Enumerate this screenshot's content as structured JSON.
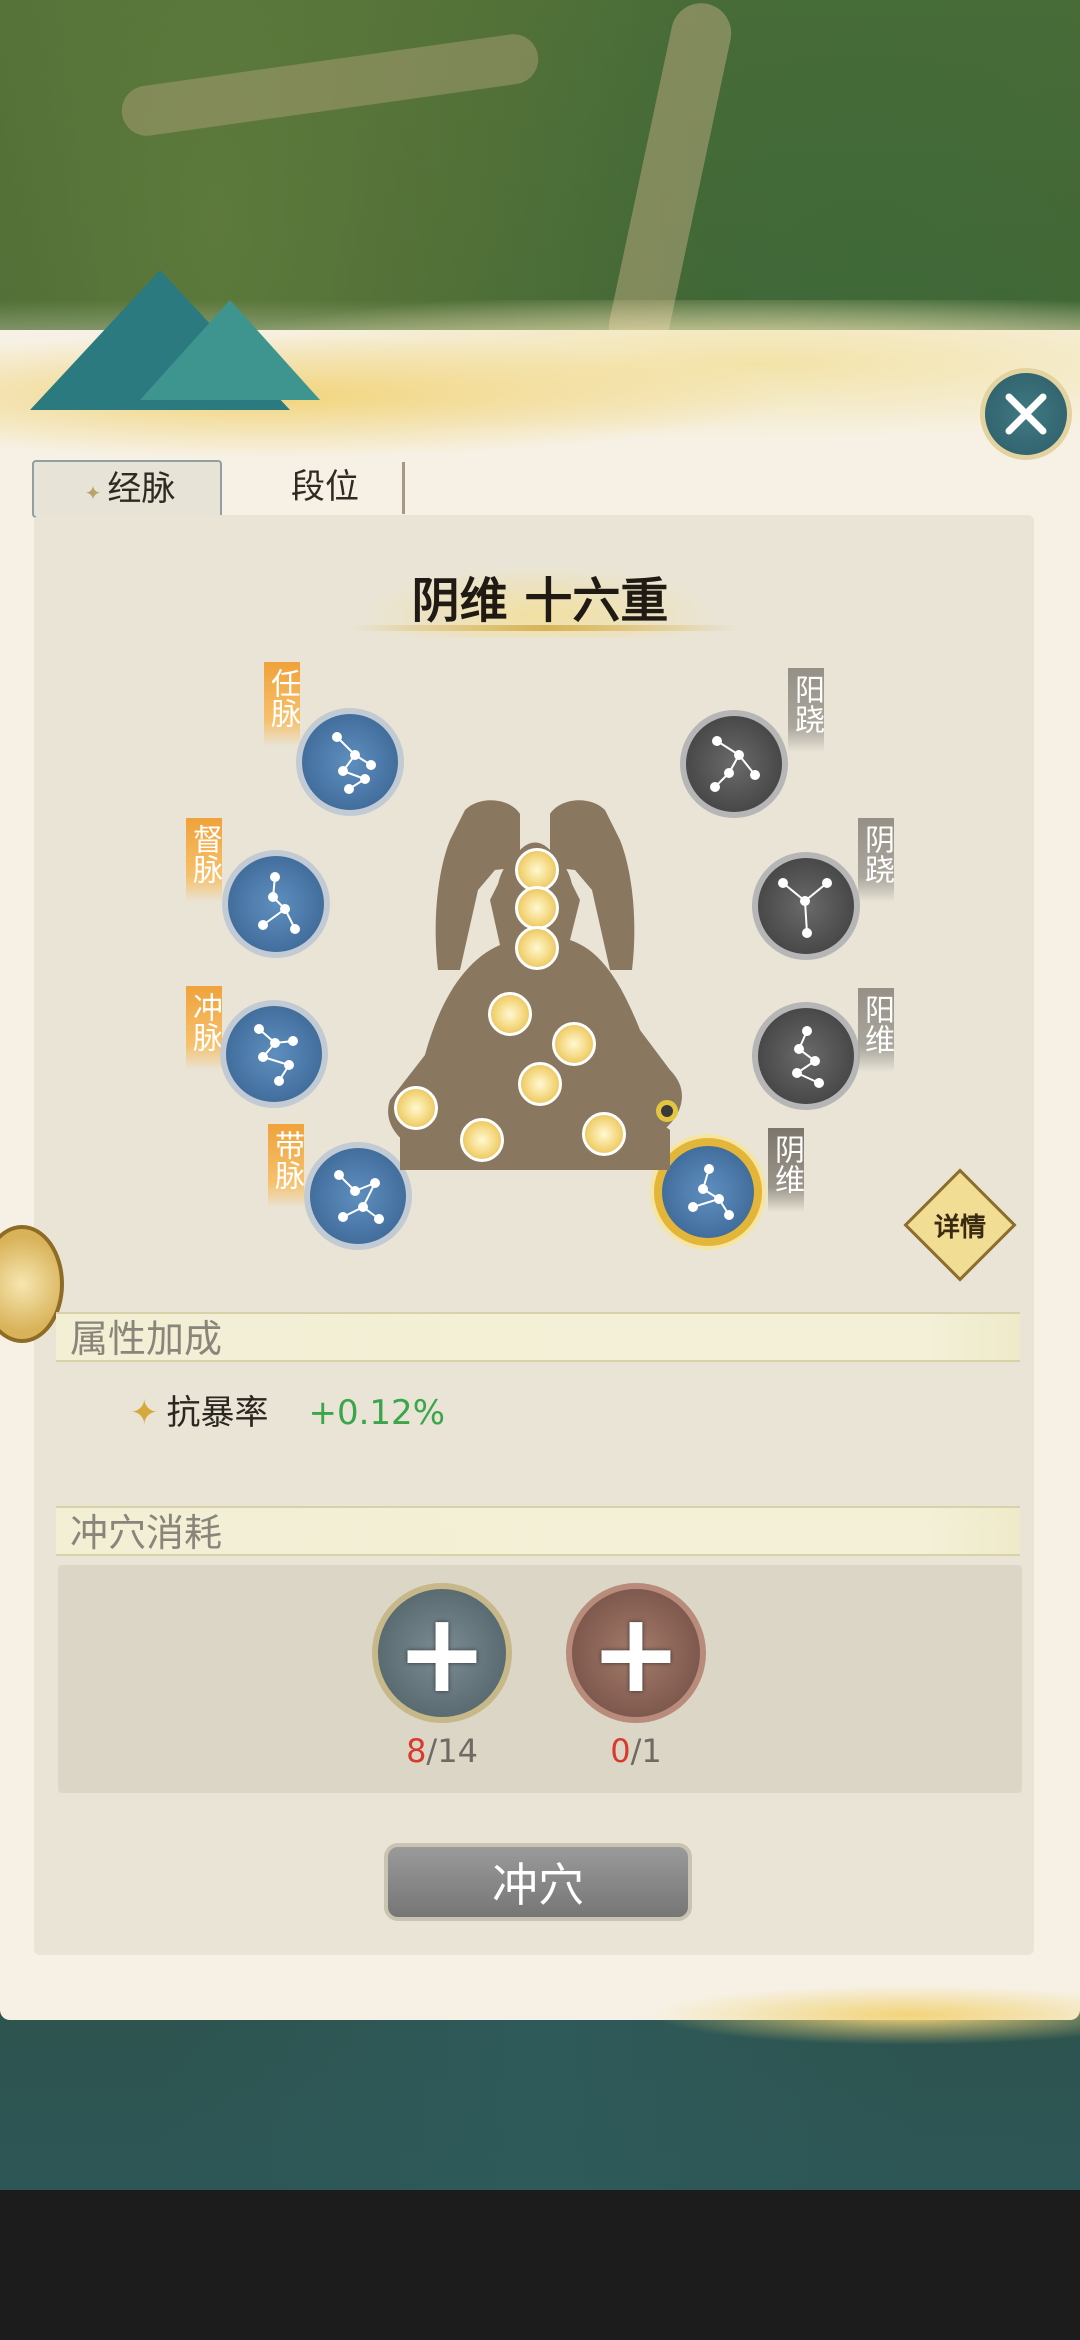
{
  "tabs": [
    {
      "label": "经脉",
      "active": true
    },
    {
      "label": "段位",
      "active": false
    }
  ],
  "header": {
    "title": "阴维 十六重"
  },
  "meridians_left": [
    {
      "label": "任脉",
      "state": "active"
    },
    {
      "label": "督脉",
      "state": "active"
    },
    {
      "label": "冲脉",
      "state": "active"
    },
    {
      "label": "带脉",
      "state": "active"
    }
  ],
  "meridians_right": [
    {
      "label": "阳跷",
      "state": "locked"
    },
    {
      "label": "阴跷",
      "state": "locked"
    },
    {
      "label": "阳维",
      "state": "locked"
    },
    {
      "label": "阴维",
      "state": "selected"
    }
  ],
  "detail_button": {
    "label": "详情"
  },
  "attributes": {
    "section_title": "属性加成",
    "items": [
      {
        "name": "抗暴率",
        "value": "+0.12%"
      }
    ]
  },
  "cost": {
    "section_title": "冲穴消耗",
    "items": [
      {
        "have": "8",
        "need": "/14",
        "icon": "plus-item-icon"
      },
      {
        "have": "0",
        "need": "/1",
        "icon": "plus-item-icon"
      }
    ]
  },
  "action_button": {
    "label": "冲穴"
  },
  "colors": {
    "panel_bg": "#f6f1e4",
    "active_tab_accent": "#f0a23a",
    "positive_value": "#3aa54a",
    "insufficient_count": "#d83b2b"
  }
}
